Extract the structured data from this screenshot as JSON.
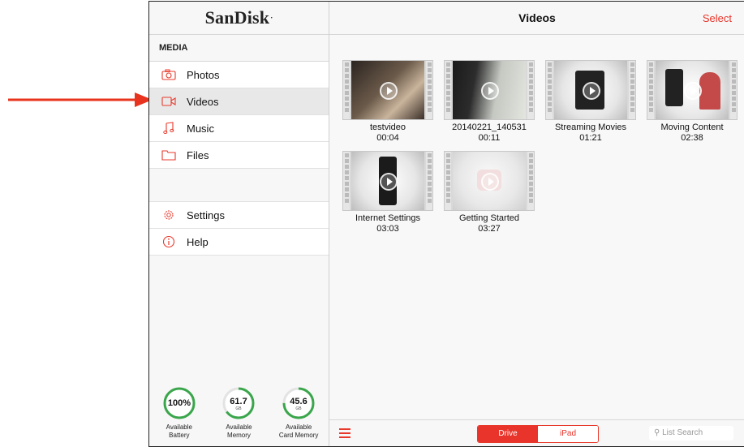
{
  "brand": {
    "name": "SanDisk",
    "mark": "·"
  },
  "sidebar": {
    "section_label": "MEDIA",
    "items": [
      {
        "label": "Photos",
        "icon": "camera-icon"
      },
      {
        "label": "Videos",
        "icon": "video-camera-icon",
        "active": true
      },
      {
        "label": "Music",
        "icon": "music-note-icon"
      },
      {
        "label": "Files",
        "icon": "folder-icon"
      }
    ],
    "secondary": [
      {
        "label": "Settings",
        "icon": "gear-icon"
      },
      {
        "label": "Help",
        "icon": "info-icon"
      }
    ],
    "gauges": [
      {
        "value": "100%",
        "unit": "",
        "label_line1": "Available",
        "label_line2": "Battery",
        "fraction": 1.0
      },
      {
        "value": "61.7",
        "unit": "GB",
        "label_line1": "Available",
        "label_line2": "Memory",
        "fraction": 0.65
      },
      {
        "value": "45.6",
        "unit": "GB",
        "label_line1": "Available",
        "label_line2": "Card Memory",
        "fraction": 0.75
      }
    ]
  },
  "header": {
    "title": "Videos",
    "select_label": "Select"
  },
  "videos": [
    {
      "name": "testvideo",
      "duration": "00:04"
    },
    {
      "name": "20140221_140531",
      "duration": "00:11"
    },
    {
      "name": "Streaming Movies",
      "duration": "01:21"
    },
    {
      "name": "Moving Content",
      "duration": "02:38"
    },
    {
      "name": "Internet Settings",
      "duration": "03:03"
    },
    {
      "name": "Getting Started",
      "duration": "03:27"
    }
  ],
  "bottombar": {
    "segments": [
      {
        "label": "Drive",
        "selected": true
      },
      {
        "label": "iPad",
        "selected": false
      }
    ],
    "search_placeholder": "List Search"
  },
  "colors": {
    "accent": "#e8342a",
    "arrow": "#e8341e"
  }
}
